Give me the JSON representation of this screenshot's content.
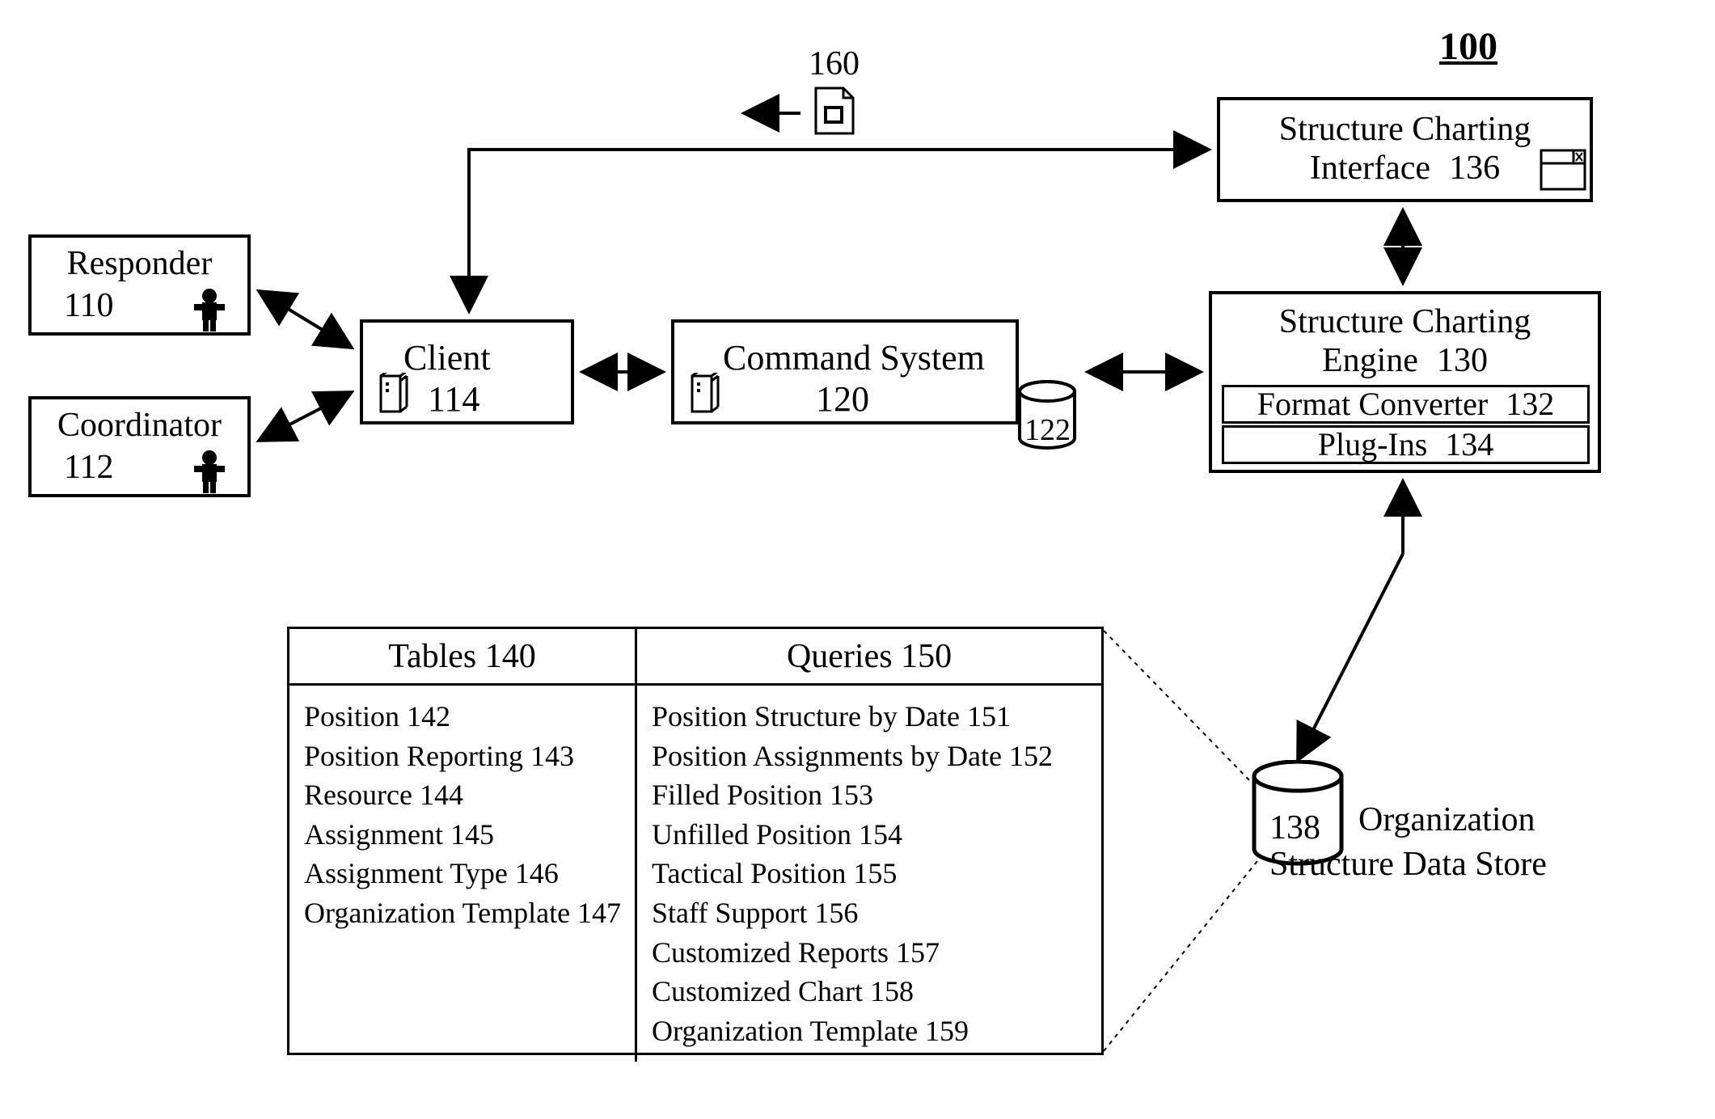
{
  "figure_number": "100",
  "responder": {
    "label": "Responder",
    "num": "110"
  },
  "coordinator": {
    "label": "Coordinator",
    "num": "112"
  },
  "client": {
    "label": "Client",
    "num": "114"
  },
  "command_system": {
    "label": "Command System",
    "num": "120",
    "db_num": "122"
  },
  "doc_num": "160",
  "charting_interface": {
    "line1": "Structure Charting",
    "line2": "Interface",
    "num": "136"
  },
  "charting_engine": {
    "line1": "Structure Charting",
    "line2": "Engine",
    "num": "130",
    "format_converter": {
      "label": "Format Converter",
      "num": "132"
    },
    "plugins": {
      "label": "Plug-Ins",
      "num": "134"
    }
  },
  "org_store": {
    "db_num": "138",
    "label_line1": "Organization",
    "label_line2": "Structure Data Store"
  },
  "tables": {
    "header": "Tables",
    "num": "140",
    "rows": [
      {
        "label": "Position",
        "num": "142"
      },
      {
        "label": "Position Reporting",
        "num": "143"
      },
      {
        "label": "Resource",
        "num": "144"
      },
      {
        "label": "Assignment",
        "num": "145"
      },
      {
        "label": "Assignment Type",
        "num": "146"
      },
      {
        "label": "Organization Template",
        "num": "147"
      }
    ]
  },
  "queries": {
    "header": "Queries",
    "num": "150",
    "rows": [
      {
        "label": "Position Structure by Date",
        "num": "151"
      },
      {
        "label": "Position Assignments by Date",
        "num": "152"
      },
      {
        "label": "Filled Position",
        "num": "153"
      },
      {
        "label": "Unfilled Position",
        "num": "154"
      },
      {
        "label": "Tactical Position",
        "num": "155"
      },
      {
        "label": "Staff Support",
        "num": "156"
      },
      {
        "label": "Customized Reports",
        "num": "157"
      },
      {
        "label": "Customized Chart",
        "num": "158"
      },
      {
        "label": "Organization Template",
        "num": "159"
      }
    ]
  }
}
